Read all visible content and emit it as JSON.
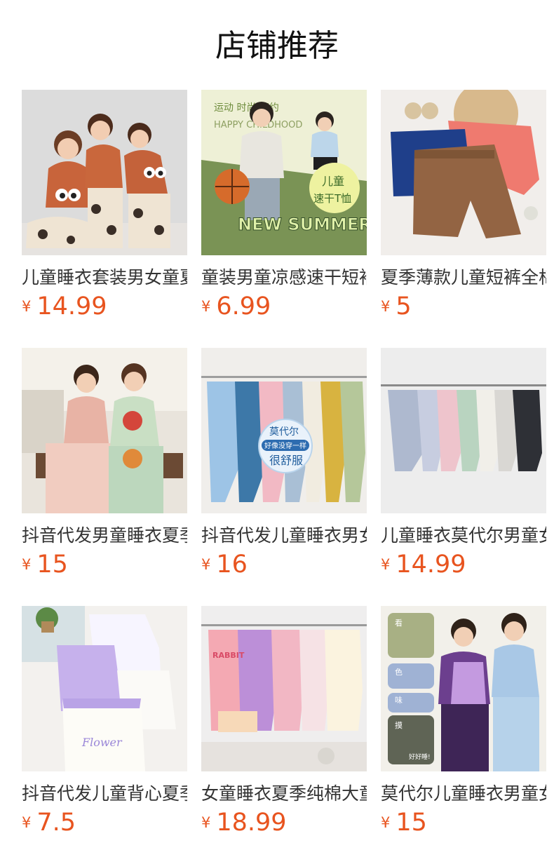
{
  "section": {
    "title": "店铺推荐"
  },
  "currency_symbol": "¥",
  "products": [
    {
      "name": "儿童睡衣套装男女童夏",
      "price": "14.99",
      "image": "kids-pajama-photo"
    },
    {
      "name": "童装男童凉感速干短袖",
      "price": "6.99",
      "image": "kids-summer-tee-photo"
    },
    {
      "name": "夏季薄款儿童短裤全棉",
      "price": "5",
      "image": "kids-shorts-photo"
    },
    {
      "name": "抖音代发男童睡衣夏季",
      "price": "15",
      "image": "kids-pajama-photo"
    },
    {
      "name": "抖音代发儿童睡衣男女",
      "price": "16",
      "image": "modal-pajama-rack-photo"
    },
    {
      "name": "儿童睡衣莫代尔男童女",
      "price": "14.99",
      "image": "pajama-rack-photo"
    },
    {
      "name": "抖音代发儿童背心夏季",
      "price": "7.5",
      "image": "camisole-photo"
    },
    {
      "name": "女童睡衣夏季纯棉大童",
      "price": "18.99",
      "image": "girls-pajama-rack-photo"
    },
    {
      "name": "莫代尔儿童睡衣男童女",
      "price": "15",
      "image": "modal-kids-pajama-photo"
    }
  ],
  "image_overlays": {
    "p2": {
      "line1": "运动 时尚 简约",
      "line2": "HAPPY CHILDHOOD",
      "badge1": "儿童",
      "badge2": "速干T恤",
      "banner": "NEW SUMMER"
    },
    "p5": {
      "t1": "莫代尔",
      "t2": "好像没穿一样",
      "t3": "很舒服"
    },
    "p7": {
      "word": "Flower"
    },
    "p8": {
      "word": "RABBIT"
    },
    "p9": {
      "a": "看",
      "b": "色",
      "c": "味",
      "d": "摸",
      "e": "好好睡!"
    }
  }
}
